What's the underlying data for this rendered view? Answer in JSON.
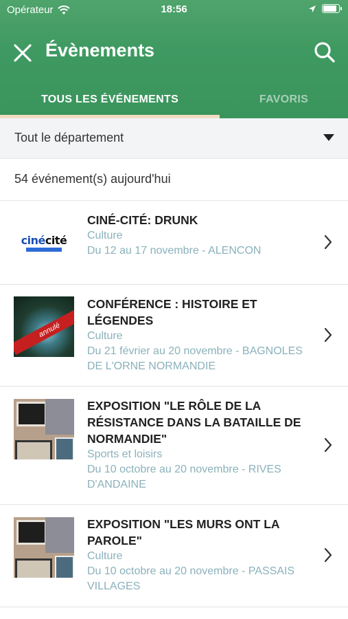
{
  "status": {
    "carrier": "Opérateur",
    "time": "18:56"
  },
  "nav": {
    "title": "Évènements"
  },
  "tabs": {
    "all": "TOUS LES ÉVÉNEMENTS",
    "favorites": "FAVORIS"
  },
  "filter": {
    "selected": "Tout le département"
  },
  "count_text": "54 événement(s) aujourd'hui",
  "colors": {
    "header_green": "#3f9a62",
    "tab_underline": "#f1ddc3",
    "meta_text": "#8ab1bb"
  },
  "events": [
    {
      "title": "CINÉ-CITÉ: DRUNK",
      "category": "Culture",
      "date": "Du 12 au 17 novembre - ALENCON",
      "thumb": "cine-cite-logo"
    },
    {
      "title": "CONFÉRENCE : HISTOIRE ET LÉGENDES",
      "category": "Culture",
      "date": "Du 21 février au 20 novembre - BAGNOLES DE L'ORNE NORMANDIE",
      "thumb": "forest-annule",
      "thumb_text": "annulé"
    },
    {
      "title": "EXPOSITION \"LE RÔLE DE LA RÉSISTANCE DANS LA BATAILLE DE NORMANDIE\"",
      "category": "Sports et loisirs",
      "date": "Du 10 octobre au 20 novembre - RIVES D'ANDAINE",
      "thumb": "exhibition-photo"
    },
    {
      "title": "EXPOSITION \"LES MURS ONT LA PAROLE\"",
      "category": "Culture",
      "date": "Du 10 octobre au 20 novembre - PASSAIS VILLAGES",
      "thumb": "exhibition-photo"
    }
  ]
}
